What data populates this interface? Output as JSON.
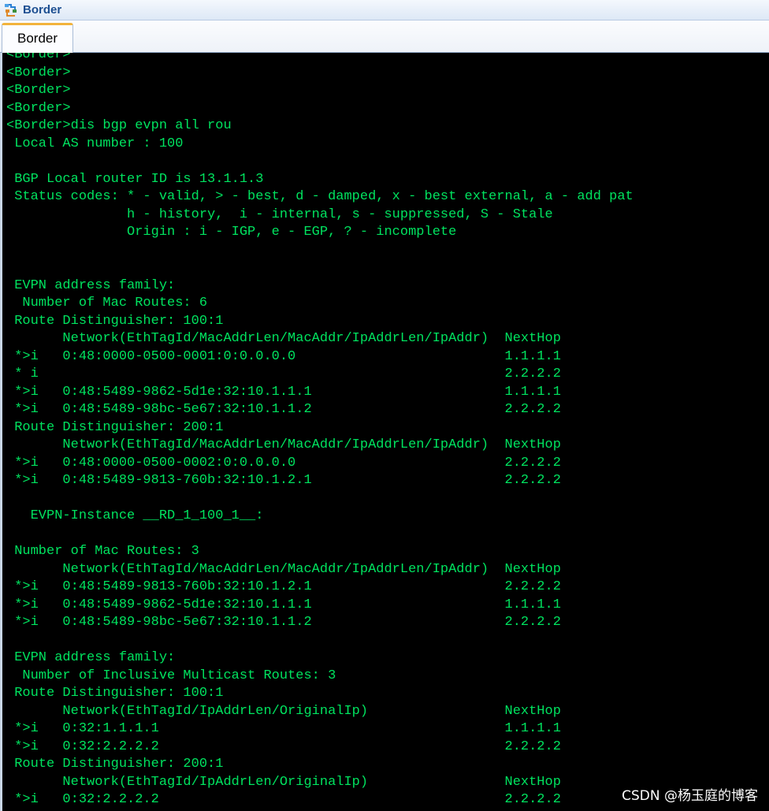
{
  "window": {
    "title": "Border",
    "icon": "app-network-icon"
  },
  "tabs": [
    {
      "label": "Border",
      "active": true
    }
  ],
  "terminal": {
    "colors": {
      "background": "#000000",
      "text": "#00e35f"
    },
    "lines": [
      "<Border>",
      "<Border>",
      "<Border>",
      "<Border>",
      "<Border>dis bgp evpn all rou",
      " Local AS number : 100",
      "",
      " BGP Local router ID is 13.1.1.3",
      " Status codes: * - valid, > - best, d - damped, x - best external, a - add pat",
      "               h - history,  i - internal, s - suppressed, S - Stale",
      "               Origin : i - IGP, e - EGP, ? - incomplete",
      "",
      "",
      " EVPN address family:",
      "  Number of Mac Routes: 6",
      " Route Distinguisher: 100:1",
      "       Network(EthTagId/MacAddrLen/MacAddr/IpAddrLen/IpAddr)  NextHop",
      " *>i   0:48:0000-0500-0001:0:0.0.0.0                          1.1.1.1",
      " * i                                                          2.2.2.2",
      " *>i   0:48:5489-9862-5d1e:32:10.1.1.1                        1.1.1.1",
      " *>i   0:48:5489-98bc-5e67:32:10.1.1.2                        2.2.2.2",
      " Route Distinguisher: 200:1",
      "       Network(EthTagId/MacAddrLen/MacAddr/IpAddrLen/IpAddr)  NextHop",
      " *>i   0:48:0000-0500-0002:0:0.0.0.0                          2.2.2.2",
      " *>i   0:48:5489-9813-760b:32:10.1.2.1                        2.2.2.2",
      "",
      "   EVPN-Instance __RD_1_100_1__:",
      "",
      " Number of Mac Routes: 3",
      "       Network(EthTagId/MacAddrLen/MacAddr/IpAddrLen/IpAddr)  NextHop",
      " *>i   0:48:5489-9813-760b:32:10.1.2.1                        2.2.2.2",
      " *>i   0:48:5489-9862-5d1e:32:10.1.1.1                        1.1.1.1",
      " *>i   0:48:5489-98bc-5e67:32:10.1.1.2                        2.2.2.2",
      "",
      " EVPN address family:",
      "  Number of Inclusive Multicast Routes: 3",
      " Route Distinguisher: 100:1",
      "       Network(EthTagId/IpAddrLen/OriginalIp)                 NextHop",
      " *>i   0:32:1.1.1.1                                           1.1.1.1",
      " *>i   0:32:2.2.2.2                                           2.2.2.2",
      " Route Distinguisher: 200:1",
      "       Network(EthTagId/IpAddrLen/OriginalIp)                 NextHop",
      " *>i   0:32:2.2.2.2                                           2.2.2.2"
    ]
  },
  "watermark": "CSDN @杨玉庭的博客"
}
